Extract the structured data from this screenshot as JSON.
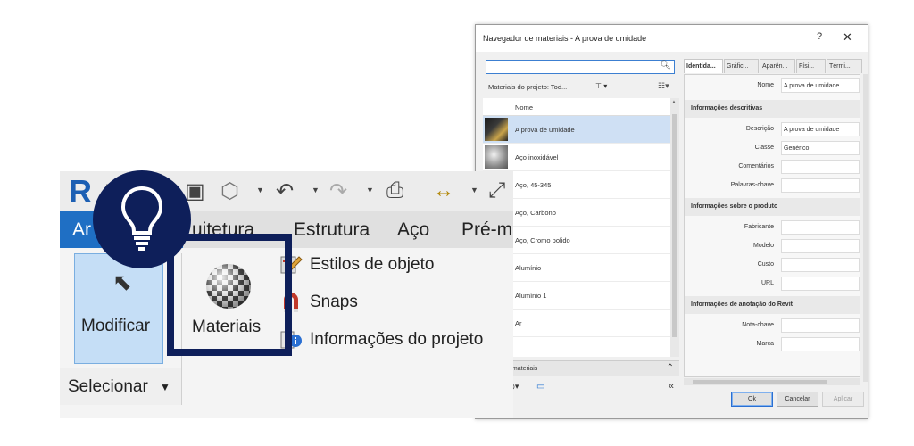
{
  "dialog": {
    "title": "Navegador de materiais - A prova de umidade",
    "help_glyph": "?",
    "close_glyph": "✕",
    "search_placeholder": "",
    "library_label": "Materiais do projeto: Tod...",
    "list_header": "Nome",
    "materials": [
      {
        "name": "A prova de umidade",
        "selected": true
      },
      {
        "name": "Aço inoxidável"
      },
      {
        "name": "Aço, 45-345"
      },
      {
        "name": "Aço, Carbono"
      },
      {
        "name": "Aço, Cromo polido"
      },
      {
        "name": "Alumínio"
      },
      {
        "name": "Alumínio 1"
      },
      {
        "name": "Ar"
      }
    ],
    "library_panel": "...as de materiais",
    "tabs": [
      "Identida...",
      "Gráfic...",
      "Aparên...",
      "Físi...",
      "Térmi..."
    ],
    "name_label": "Nome",
    "name_value": "A prova de umidade",
    "sections": {
      "descriptive": "Informações descritivas",
      "product": "Informações sobre o produto",
      "annotation": "Informações de anotação do Revit"
    },
    "props": {
      "descricao_label": "Descrição",
      "descricao_value": "A prova de umidade",
      "classe_label": "Classe",
      "classe_value": "Genérico",
      "comentarios_label": "Comentários",
      "palavras_label": "Palavras-chave",
      "fabricante_label": "Fabricante",
      "modelo_label": "Modelo",
      "custo_label": "Custo",
      "url_label": "URL",
      "notachave_label": "Nota-chave",
      "marca_label": "Marca"
    },
    "buttons": {
      "ok": "Ok",
      "cancel": "Cancelar",
      "apply": "Aplicar"
    }
  },
  "ribbon": {
    "logo": "R",
    "tabs": {
      "arquitetura": "Ar",
      "arquitetura_tail": "uitetura",
      "estrutura": "Estrutura",
      "aco": "Aço",
      "pre": "Pré-m"
    },
    "modify_label": "Modificar",
    "select_label": "Selecionar",
    "materials_label": "Materiais",
    "settings_items": [
      {
        "label": "Estilos de  objeto",
        "icon": "object-styles-icon"
      },
      {
        "label": "Snaps",
        "icon": "snaps-icon"
      },
      {
        "label": "Informações  do  projeto",
        "icon": "project-info-icon"
      }
    ]
  },
  "colors": {
    "navy": "#0e1f5a",
    "revit_blue": "#1f6fc4",
    "selection": "#cfe0f4"
  }
}
